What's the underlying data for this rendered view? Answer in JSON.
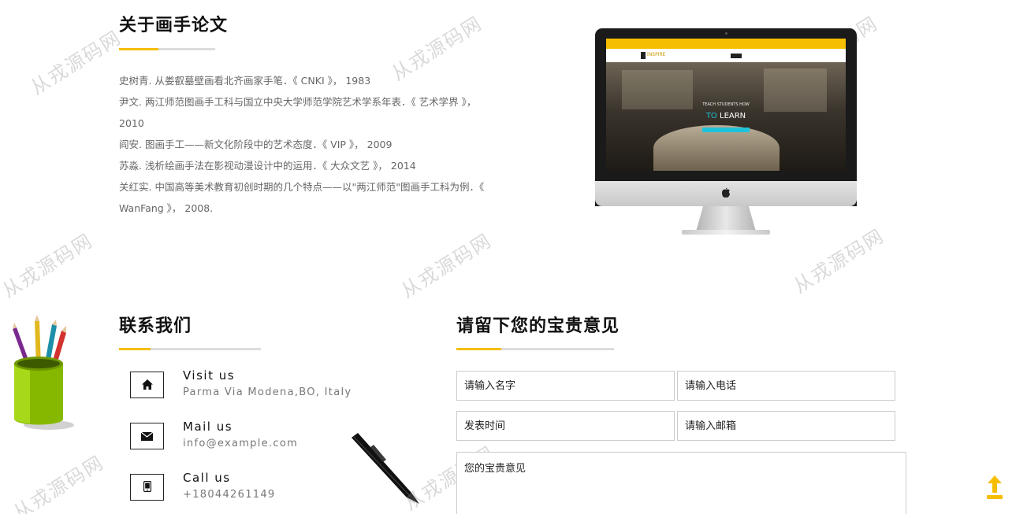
{
  "papers": {
    "title": "关于画手论文",
    "refs": [
      "史树青. 从娄叡墓壁画看北齐画家手笔．《 CNKI 》， 1983",
      "尹文. 两江师范图画手工科与国立中央大学师范学院艺术学系年表．《 艺术学界 》，",
      "2010",
      "阎安. 图画手工——新文化阶段中的艺术态度．《 VIP 》， 2009",
      "苏淼. 浅析绘画手法在影视动漫设计中的运用．《 大众文艺 》， 2014",
      "关红实. 中国高等美术教育初创时期的几个特点——以\"两江师范\"图画手工科为例．《",
      "WanFang 》， 2008."
    ]
  },
  "monitor": {
    "brand": "INSPIRE",
    "hero_line1": "TEACH STUDENTS HOW",
    "hero_line2_accent": "TO",
    "hero_line2": "LEARN"
  },
  "contact": {
    "title": "联系我们",
    "items": [
      {
        "title": "Visit us",
        "sub": "Parma Via Modena,BO, Italy",
        "icon": "home-icon"
      },
      {
        "title": "Mail us",
        "sub": "info@example.com",
        "icon": "mail-icon"
      },
      {
        "title": "Call us",
        "sub": "+18044261149",
        "icon": "phone-icon"
      }
    ]
  },
  "feedback": {
    "title": "请留下您的宝贵意见",
    "name_placeholder": "请输入名字",
    "phone_placeholder": "请输入电话",
    "time_placeholder": "发表时间",
    "email_placeholder": "请输入邮箱",
    "message_placeholder": "您的宝贵意见"
  },
  "watermark": "从戎源码网",
  "colors": {
    "accent": "#f6be00",
    "cyan": "#1ec3d8"
  }
}
